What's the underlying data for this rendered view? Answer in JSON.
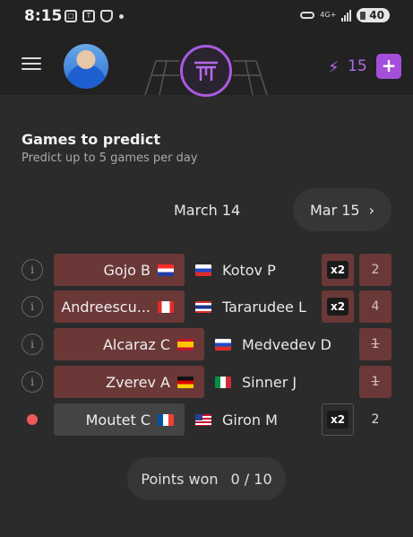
{
  "status_bar": {
    "time": "8:15",
    "icons": [
      "screenshot-icon",
      "app-icon",
      "shield-icon"
    ],
    "network": "4G+",
    "battery": "40"
  },
  "header": {
    "energy_count": "15",
    "add_label": "+",
    "accent_color": "#a44fdc"
  },
  "section": {
    "title": "Games to predict",
    "subtitle": "Predict up to 5 games per day"
  },
  "dates": {
    "current": "March 14",
    "next": "Mar 15",
    "next_chevron": "›"
  },
  "matches": [
    {
      "marker": "i",
      "player1": "Gojo B",
      "flag1": "croatia-flag",
      "player2": "Kotov P",
      "flag2": "russia-flag",
      "multiplier": "x2",
      "points": "2"
    },
    {
      "marker": "i",
      "player1": "Andreescu...",
      "flag1": "canada-flag",
      "player2": "Tararudee L",
      "flag2": "thailand-flag",
      "multiplier": "x2",
      "points": "4"
    },
    {
      "marker": "i",
      "player1": "Alcaraz C",
      "flag1": "spain-flag",
      "player2": "Medvedev D",
      "flag2": "russia-flag",
      "multiplier": "",
      "points": "1"
    },
    {
      "marker": "i",
      "player1": "Zverev A",
      "flag1": "germany-flag",
      "player2": "Sinner J",
      "flag2": "italy-flag",
      "multiplier": "",
      "points": "1"
    },
    {
      "marker": "live",
      "player1": "Moutet C",
      "flag1": "france-flag",
      "player2": "Giron M",
      "flag2": "usa-flag",
      "multiplier": "x2",
      "points": "2"
    }
  ],
  "points_won": {
    "label": "Points won",
    "value": "0 / 10"
  }
}
